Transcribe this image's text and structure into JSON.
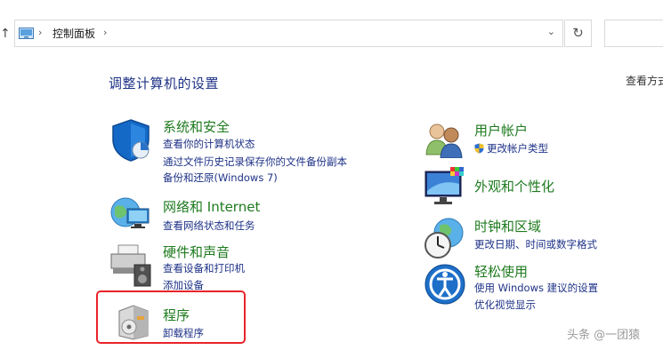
{
  "address_bar": {
    "breadcrumb": "控制面板",
    "separator": "›",
    "dropdown_glyph": "⌄",
    "refresh_glyph": "↻"
  },
  "page_title": "调整计算机的设置",
  "view_by_label": "查看方式",
  "categories": {
    "system_security": {
      "title": "系统和安全",
      "links": [
        "查看你的计算机状态",
        "通过文件历史记录保存你的文件备份副本",
        "备份和还原(Windows 7)"
      ]
    },
    "network": {
      "title": "网络和 Internet",
      "links": [
        "查看网络状态和任务"
      ]
    },
    "hardware": {
      "title": "硬件和声音",
      "links": [
        "查看设备和打印机",
        "添加设备"
      ]
    },
    "programs": {
      "title": "程序",
      "links": [
        "卸载程序"
      ]
    },
    "user_accounts": {
      "title": "用户帐户",
      "links": [
        "更改帐户类型"
      ]
    },
    "appearance": {
      "title": "外观和个性化",
      "links": []
    },
    "clock_region": {
      "title": "时钟和区域",
      "links": [
        "更改日期、时间或数字格式"
      ]
    },
    "ease_of_access": {
      "title": "轻松使用",
      "links": [
        "使用 Windows 建议的设置",
        "优化视觉显示"
      ]
    }
  },
  "watermark": "头条 @一团猿",
  "colors": {
    "category_title": "#1e7a1e",
    "link": "#1e3287",
    "highlight": "#e8232a"
  }
}
